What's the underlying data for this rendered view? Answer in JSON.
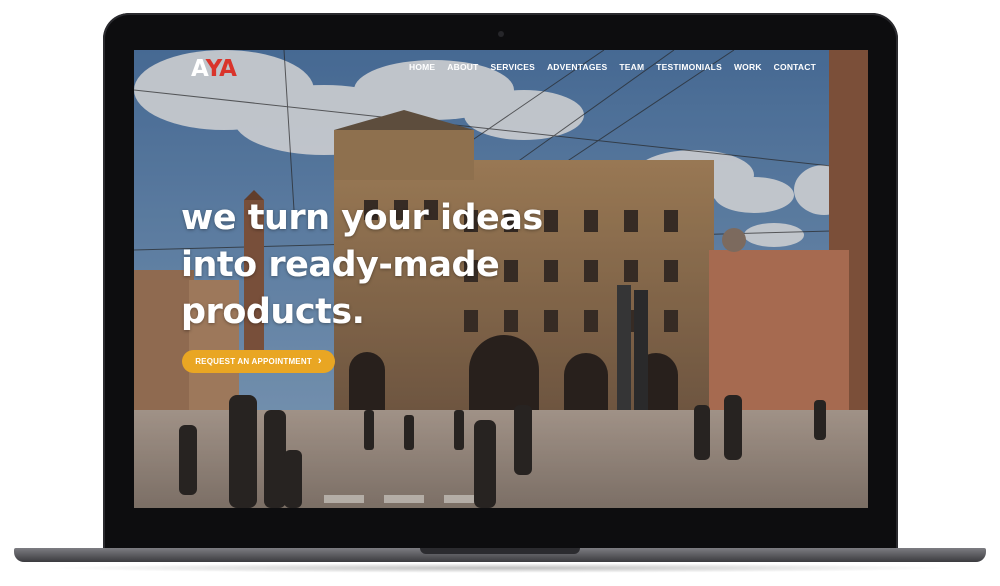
{
  "site": {
    "logo": {
      "first": "A",
      "rest": "YA"
    },
    "nav": [
      {
        "label": "HOME"
      },
      {
        "label": "ABOUT"
      },
      {
        "label": "SERVICES"
      },
      {
        "label": "ADVENTAGES"
      },
      {
        "label": "TEAM"
      },
      {
        "label": "TESTIMONIALS"
      },
      {
        "label": "WORK"
      },
      {
        "label": "CONTACT"
      }
    ]
  },
  "hero": {
    "headline": [
      "we turn your ideas",
      "into ready-made",
      "products."
    ],
    "cta_label": "REQUEST AN APPOINTMENT",
    "cta_icon": "chevron-right-icon"
  },
  "colors": {
    "accent": "#e9a623",
    "logo_red": "#d9342b",
    "laptop_bezel": "#0d0d0f"
  }
}
